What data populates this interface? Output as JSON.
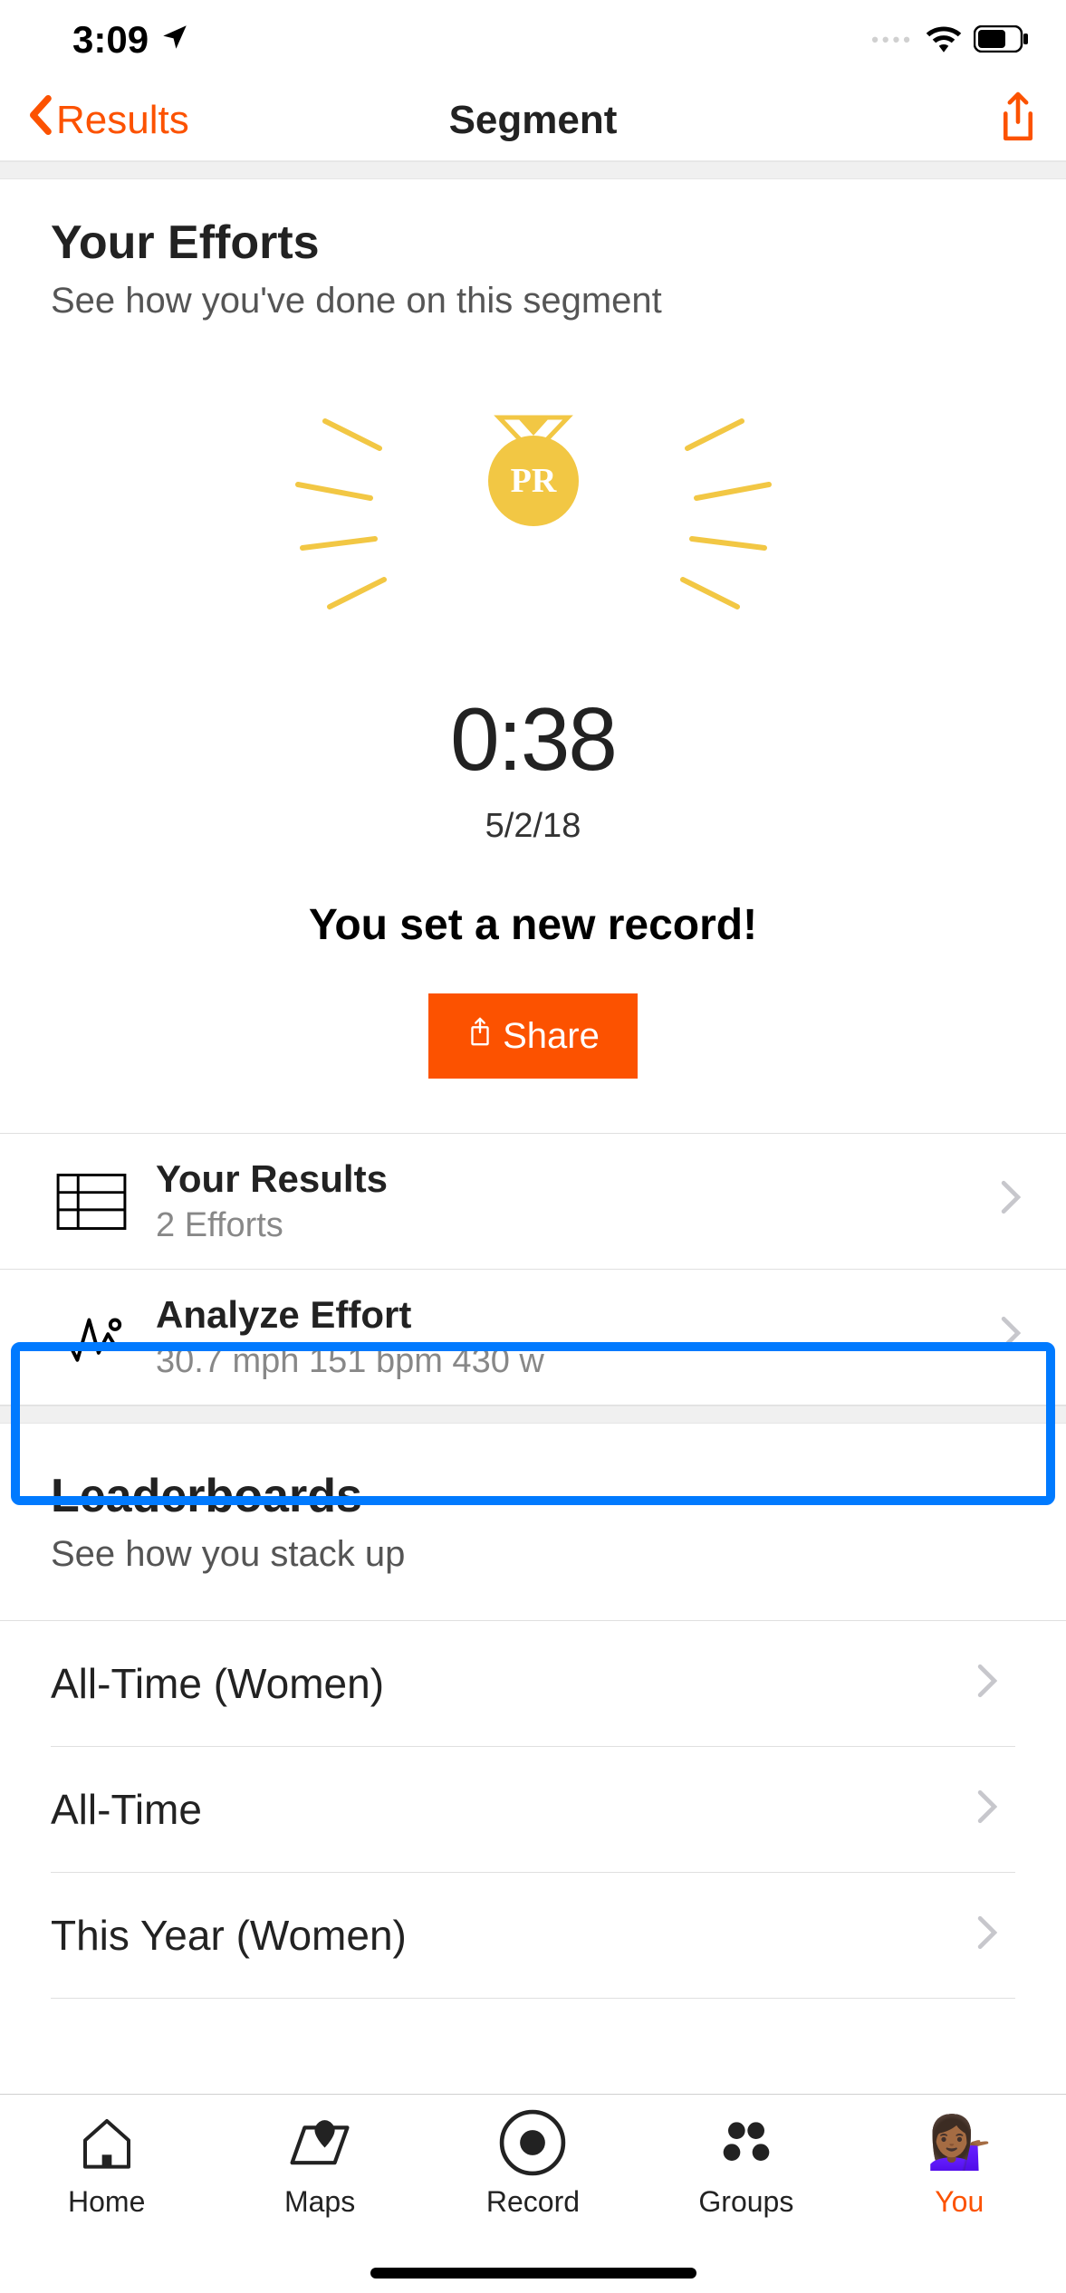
{
  "status": {
    "time": "3:09"
  },
  "nav": {
    "back": "Results",
    "title": "Segment"
  },
  "efforts": {
    "heading": "Your Efforts",
    "sub": "See how you've done on this segment",
    "pr_badge": "PR",
    "pr_time": "0:38",
    "pr_date": "5/2/18",
    "record_msg": "You set a new record!",
    "share_label": "Share"
  },
  "rows": {
    "results": {
      "title": "Your Results",
      "sub": "2 Efforts"
    },
    "analyze": {
      "title": "Analyze Effort",
      "sub": "30.7 mph 151 bpm 430 w"
    }
  },
  "leaderboards": {
    "heading": "Leaderboards",
    "sub": "See how you stack up",
    "items": [
      {
        "label": "All-Time (Women)"
      },
      {
        "label": "All-Time"
      },
      {
        "label": "This Year (Women)"
      }
    ]
  },
  "tabs": {
    "home": "Home",
    "maps": "Maps",
    "record": "Record",
    "groups": "Groups",
    "you": "You"
  }
}
